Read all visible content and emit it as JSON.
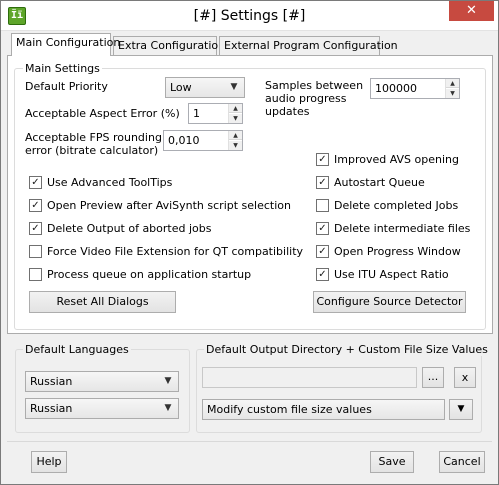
{
  "window": {
    "title": "[#] Settings [#]",
    "icon_text": "Ïï"
  },
  "tabs": [
    {
      "label": "Main Configuration"
    },
    {
      "label": "Extra Configuration"
    },
    {
      "label": "External Program Configuration"
    }
  ],
  "main_settings": {
    "group_title": "Main Settings",
    "default_priority": {
      "label": "Default Priority",
      "value": "Low"
    },
    "samples": {
      "label_line1": "Samples between",
      "label_line2": "audio progress",
      "label_line3": "updates",
      "value": "100000"
    },
    "aspect_error": {
      "label": "Acceptable Aspect Error (%)",
      "value": "1"
    },
    "fps_rounding": {
      "label_line1": "Acceptable FPS rounding",
      "label_line2": "error (bitrate calculator)",
      "value": "0,010"
    },
    "checkboxes_left": [
      {
        "label": "Use Advanced ToolTips",
        "checked": true
      },
      {
        "label": "Open Preview after AviSynth script selection",
        "checked": true
      },
      {
        "label": "Delete Output of aborted jobs",
        "checked": true
      },
      {
        "label": "Force Video File Extension for QT compatibility",
        "checked": false
      },
      {
        "label": "Process queue on application startup",
        "checked": false
      }
    ],
    "checkboxes_right": [
      {
        "label": "Improved AVS opening",
        "checked": true
      },
      {
        "label": "Autostart Queue",
        "checked": true
      },
      {
        "label": "Delete completed Jobs",
        "checked": false
      },
      {
        "label": "Delete intermediate files",
        "checked": true
      },
      {
        "label": "Open Progress Window",
        "checked": true
      },
      {
        "label": "Use ITU Aspect Ratio",
        "checked": true
      }
    ],
    "reset_button": "Reset All Dialogs",
    "configure_button": "Configure Source Detector"
  },
  "languages": {
    "group_title": "Default Languages",
    "first": "Russian",
    "second": "Russian"
  },
  "output": {
    "group_title": "Default Output Directory + Custom File Size Values",
    "path_value": "",
    "browse_label": "...",
    "clear_label": "x",
    "file_size_value": "Modify custom file size values"
  },
  "footer": {
    "help": "Help",
    "save": "Save",
    "cancel": "Cancel"
  },
  "glyphs": {
    "check": "✓",
    "arrow_down": "▼",
    "spin_up": "▲",
    "spin_down": "▼",
    "close": "✕"
  }
}
